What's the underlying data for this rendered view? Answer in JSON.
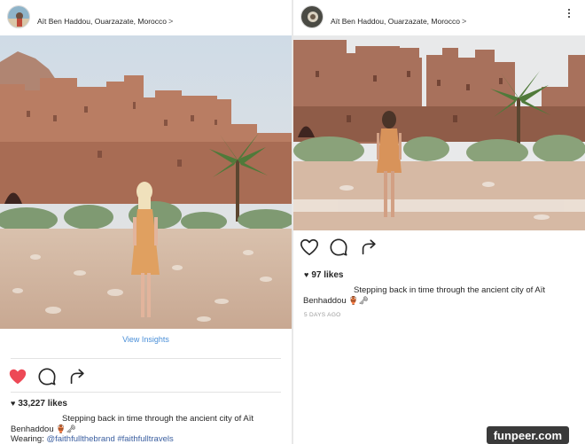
{
  "left_post": {
    "location": "Aït Ben Haddou, Ouarzazate, Morocco",
    "chevron": ">",
    "insights_label": "View Insights",
    "likes": "33,227 likes",
    "caption_line1": "Stepping back in time through the ancient city of Aït",
    "caption_line2": "Benhaddou",
    "caption_emojis": "🏺🗝",
    "tags_prefix": "Wearing: ",
    "tags_values": "@faithfullthebrand #faithfulltravels",
    "liked": true
  },
  "right_post": {
    "location": "Aït Ben Haddou, Ouarzazate, Morocco",
    "chevron": ">",
    "likes": "97 likes",
    "caption_line1": "Stepping back in time through the ancient city of Aït",
    "caption_line2": "Benhaddou",
    "caption_emojis": "🏺🗝",
    "timestamp": "5 DAYS AGO",
    "liked": false
  },
  "watermark": "funpeer.com",
  "icons": {
    "like": "heart-icon",
    "comment": "comment-icon",
    "share": "share-icon",
    "more": "more-options-icon"
  },
  "colors": {
    "liked_heart": "#ed4956",
    "link_blue": "#4a8fd8",
    "hashtag_blue": "#3b5fa0"
  }
}
